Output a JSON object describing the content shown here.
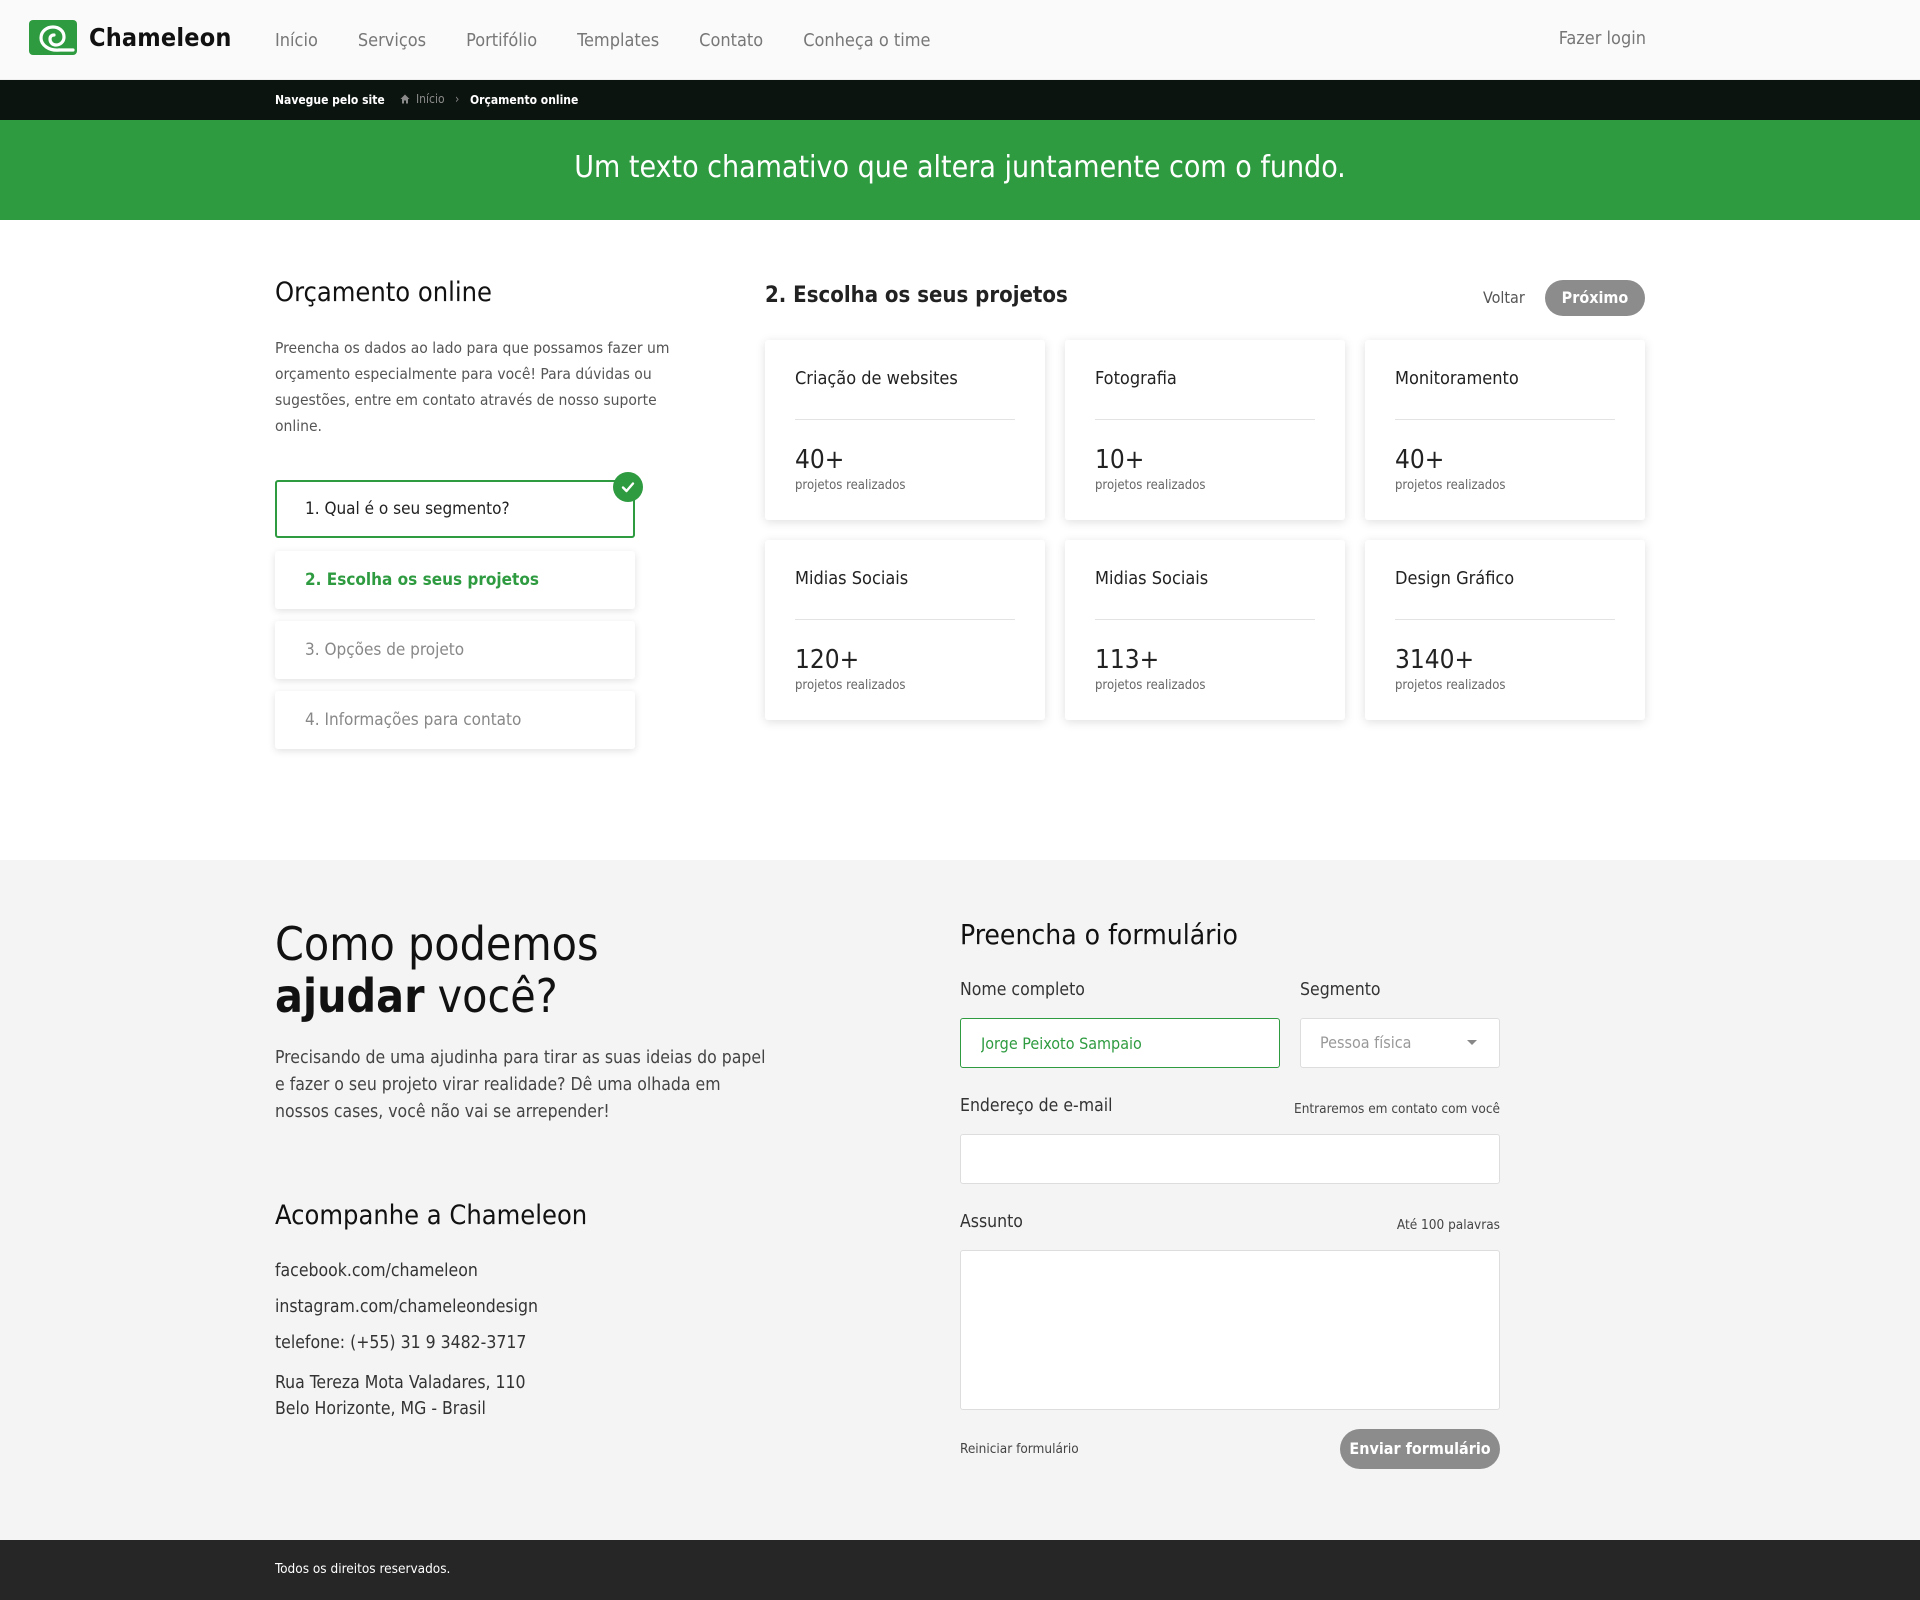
{
  "header": {
    "brand": "Chameleon",
    "nav": [
      "Início",
      "Serviços",
      "Portifólio",
      "Templates",
      "Contato",
      "Conheça o time"
    ],
    "login": "Fazer login"
  },
  "breadcrumb": {
    "title": "Navegue pelo site",
    "home": "Início",
    "separator": "›",
    "current": "Orçamento online"
  },
  "banner": {
    "text": "Um texto chamativo que altera juntamente com o fundo."
  },
  "intro": {
    "title": "Orçamento online",
    "text": "Preencha os dados ao lado para que possamos fazer um orçamento especialmente para você! Para dúvidas ou sugestões, entre em contato através de nosso suporte online."
  },
  "steps": [
    {
      "label": "1. Qual é o seu segmento?",
      "state": "done"
    },
    {
      "label": "2. Escolha os seus projetos",
      "state": "active"
    },
    {
      "label": "3. Opções de projeto",
      "state": "pending"
    },
    {
      "label": "4. Informações para contato",
      "state": "pending"
    }
  ],
  "projects": {
    "title": "2. Escolha os seus projetos",
    "back": "Voltar",
    "next": "Próximo",
    "cards": [
      {
        "name": "Criação de websites",
        "count": "40+",
        "sub": "projetos realizados"
      },
      {
        "name": "Fotografia",
        "count": "10+",
        "sub": "projetos realizados"
      },
      {
        "name": "Monitoramento",
        "count": "40+",
        "sub": "projetos realizados"
      },
      {
        "name": "Midias Sociais",
        "count": "120+",
        "sub": "projetos realizados"
      },
      {
        "name": "Midias Sociais",
        "count": "113+",
        "sub": "projetos realizados"
      },
      {
        "name": "Design Gráfico",
        "count": "3140+",
        "sub": "projetos realizados"
      }
    ]
  },
  "help": {
    "title_line1": "Como podemos",
    "title_bold": "ajudar",
    "title_rest": " você?",
    "text": "Precisando de uma ajudinha para tirar as suas ideias do papel e fazer o seu projeto virar realidade? Dê uma olhada em nossos cases, você não vai se arrepender!"
  },
  "follow": {
    "title": "Acompanhe a Chameleon",
    "facebook": "facebook.com/chameleon",
    "instagram": "instagram.com/chameleondesign",
    "phone": "telefone: (+55) 31 9 3482-3717",
    "address1": "Rua Tereza Mota Valadares, 110",
    "address2": "Belo Horizonte, MG - Brasil"
  },
  "form": {
    "title": "Preencha o formulário",
    "name_label": "Nome completo",
    "name_value": "Jorge Peixoto Sampaio",
    "segment_label": "Segmento",
    "segment_value": "Pessoa física",
    "email_label": "Endereço de e-mail",
    "email_hint": "Entraremos em contato com você",
    "email_value": "",
    "subject_label": "Assunto",
    "subject_hint": "Até 100 palavras",
    "subject_value": "",
    "reset": "Reiniciar formulário",
    "submit": "Enviar formulário"
  },
  "footer": {
    "text": "Todos os direitos reservados."
  },
  "colors": {
    "accent": "#2e9b40",
    "dark": "#0c140f",
    "button_gray": "#8c8c8c",
    "footer": "#262626"
  }
}
